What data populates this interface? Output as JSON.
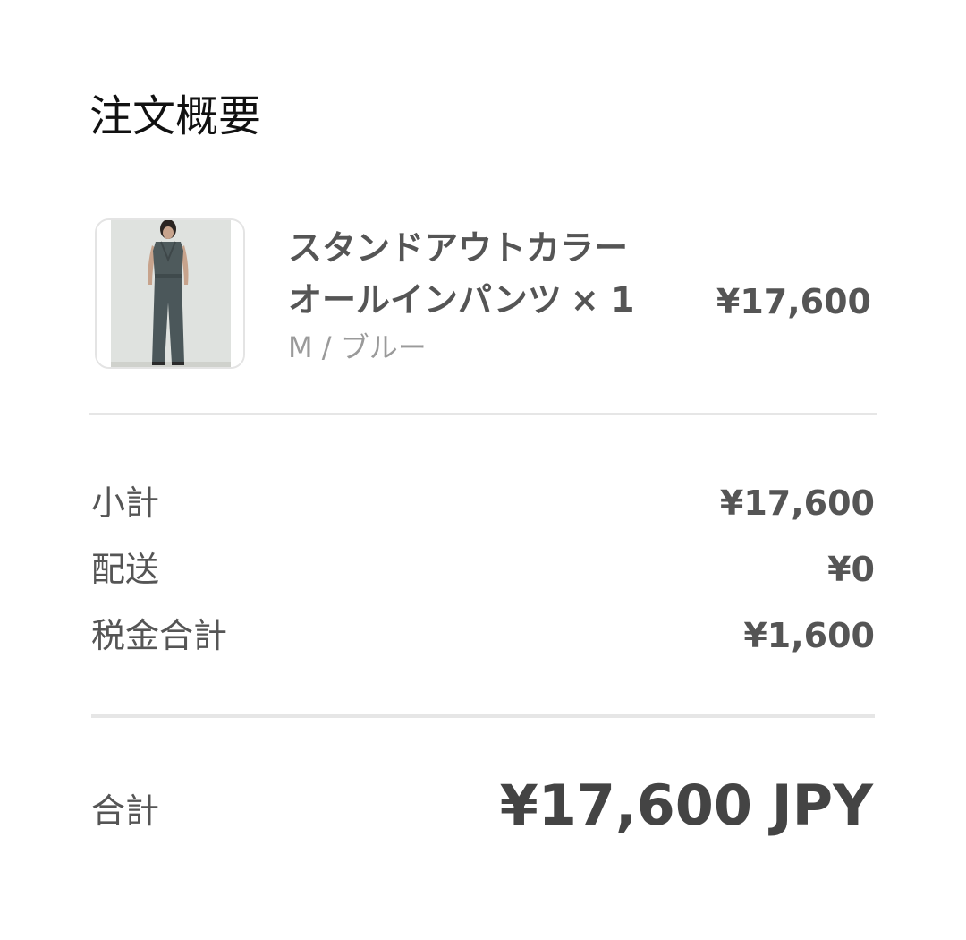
{
  "summary": {
    "title": "注文概要"
  },
  "item": {
    "name_line1": "スタンドアウトカラー",
    "name_line2": "オールインパンツ",
    "quantity": "× 1",
    "variant": "M / ブルー",
    "price": "¥17,600",
    "image_icon": "product-photo"
  },
  "breakdown": {
    "subtotal_label": "小計",
    "subtotal_value": "¥17,600",
    "shipping_label": "配送",
    "shipping_value": "¥0",
    "tax_label": "税金合計",
    "tax_value": "¥1,600"
  },
  "total": {
    "label": "合計",
    "value": "¥17,600 JPY"
  },
  "colors": {
    "background": "#ffffff",
    "divider": "#e6e6e6",
    "text_primary": "#444444",
    "text_muted": "#9a9a9a"
  }
}
